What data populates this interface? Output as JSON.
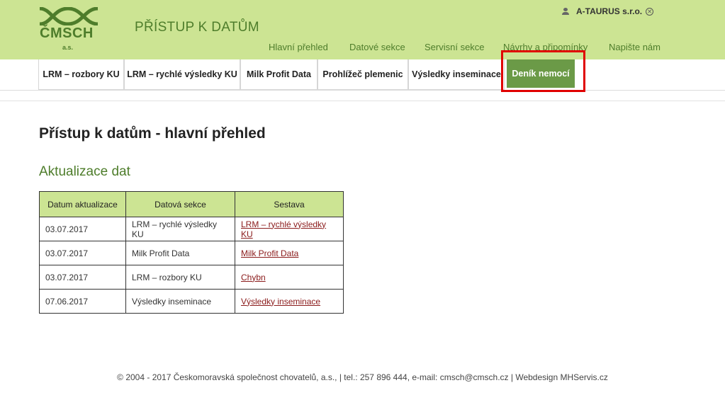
{
  "header": {
    "logo_text": "ČMSCH",
    "logo_sub": "a.s.",
    "app_title": "PŘÍSTUP K DATŮM",
    "user_name": "A-TAURUS s.r.o.",
    "logout_symbol": "✕"
  },
  "main_nav": [
    "Hlavní přehled",
    "Datové sekce",
    "Servisní sekce",
    "Návrhy a připomínky",
    "Napište nám"
  ],
  "sub_nav": [
    {
      "label": "LRM – rozbory KU",
      "active": false
    },
    {
      "label": "LRM – rychlé výsledky KU",
      "active": false
    },
    {
      "label": "Milk Profit Data",
      "active": false
    },
    {
      "label": "Prohlížeč plemenic",
      "active": false
    },
    {
      "label": "Výsledky inseminace",
      "active": false
    },
    {
      "label": "Deník nemocí",
      "active": true
    }
  ],
  "page": {
    "title": "Přístup k datům - hlavní přehled",
    "section_title": "Aktualizace dat"
  },
  "table": {
    "headers": [
      "Datum aktualizace",
      "Datová sekce",
      "Sestava"
    ],
    "rows": [
      {
        "date": "03.07.2017",
        "section": "LRM – rychlé výsledky KU",
        "report": "LRM – rychlé výsledky KU"
      },
      {
        "date": "03.07.2017",
        "section": "Milk Profit Data",
        "report": "Milk Profit Data"
      },
      {
        "date": "03.07.2017",
        "section": "LRM – rozbory KU",
        "report": "Chybn"
      },
      {
        "date": "07.06.2017",
        "section": "Výsledky inseminace",
        "report": "Výsledky inseminace"
      }
    ]
  },
  "footer": {
    "text": "© 2004 - 2017 Českomoravská společnost chovatelů, a.s., | tel.: 257 896 444, e-mail: cmsch@cmsch.cz | Webdesign MHServis.cz"
  },
  "colors": {
    "header_bg": "#cce493",
    "brand_green": "#4e7d2b",
    "active_tab": "#6b9a47",
    "link": "#8a1a1a",
    "highlight": "#e00000"
  }
}
